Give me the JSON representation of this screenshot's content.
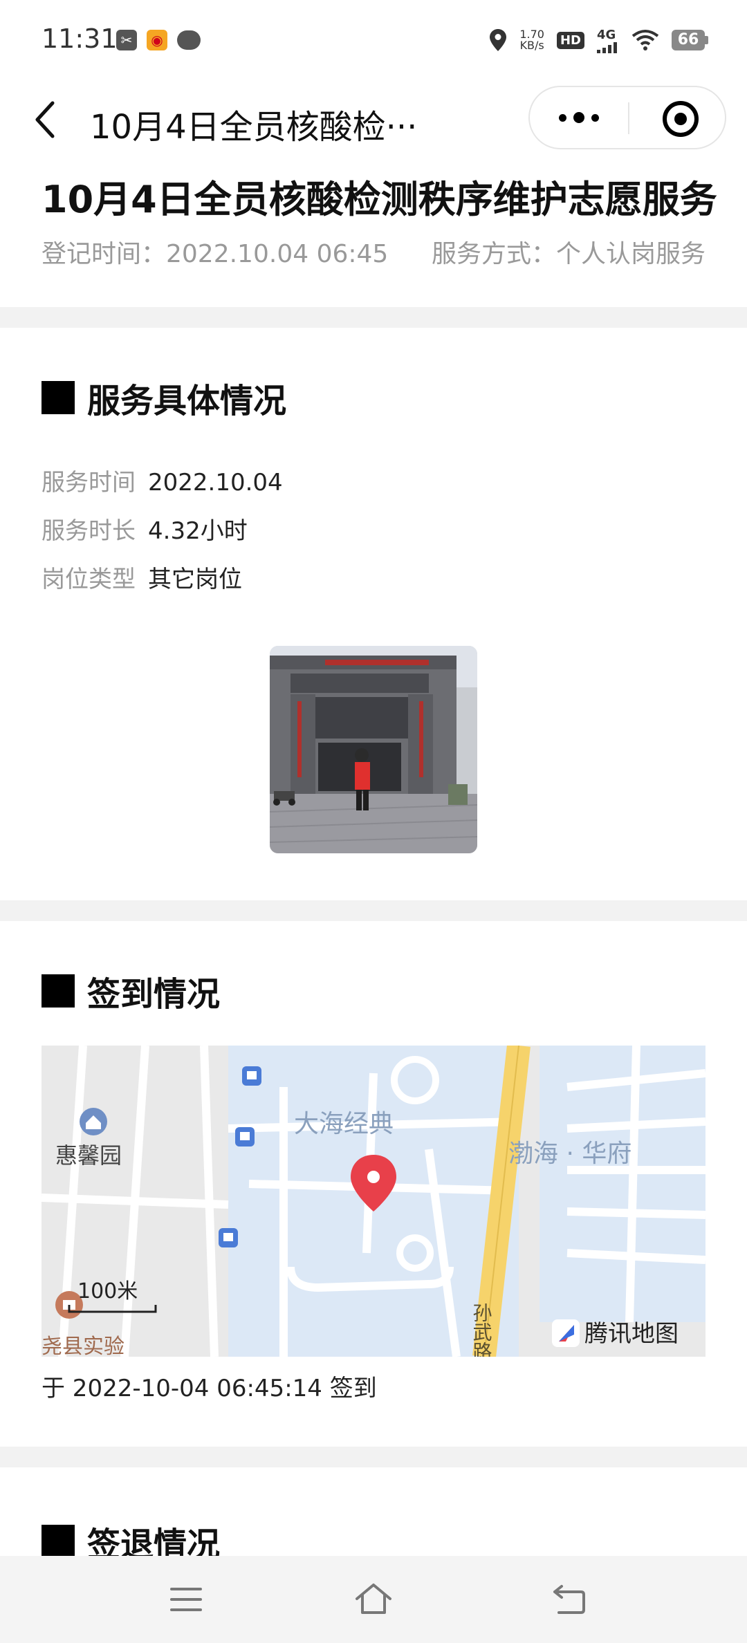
{
  "status_bar": {
    "time": "11:31",
    "network_speed_value": "1.70",
    "network_speed_unit": "KB/s",
    "hd_label": "HD",
    "signal_label": "4G",
    "battery": "66",
    "icons": [
      "scissors-app-icon",
      "weibo-icon",
      "chat-bubble-icon",
      "location-icon",
      "wifi-icon"
    ]
  },
  "nav": {
    "title": "10月4日全员核酸检···"
  },
  "header": {
    "title": "10月4日全员核酸检测秩序维护志愿服务",
    "register_time": "登记时间：2022.10.04 06:45",
    "service_mode": "服务方式：个人认岗服务"
  },
  "service_detail": {
    "section_title": "服务具体情况",
    "rows": [
      {
        "label": "服务时间",
        "value": "2022.10.04"
      },
      {
        "label": "服务时长",
        "value": "4.32小时"
      },
      {
        "label": "岗位类型",
        "value": "其它岗位"
      }
    ]
  },
  "signin": {
    "section_title": "签到情况",
    "map": {
      "labels": {
        "dahai": "大海经典",
        "bohai": "渤海 · 华府",
        "huixin": "惠馨园",
        "road": "孙武路",
        "school": "尧县实验",
        "scale": "100米",
        "provider": "腾讯地图"
      }
    },
    "caption": "于 2022-10-04 06:45:14 签到"
  },
  "signout": {
    "section_title": "签退情况"
  },
  "colors": {
    "map_block": "#dce8f6",
    "map_road_major": "#f6d36b",
    "map_bg": "#e9e9e9",
    "pin": "#e8404a",
    "vest": "#e0302e"
  }
}
